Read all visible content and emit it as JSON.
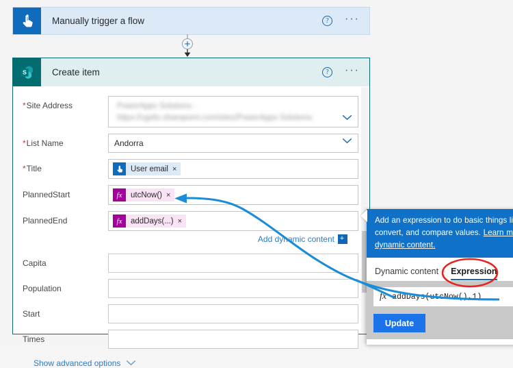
{
  "theme": {
    "trigger_accent": "#0f6cbd",
    "action_accent": "#036c70",
    "link_blue": "#2d7cc4",
    "annotation_blue": "#1a8cd8",
    "annotation_red": "#e8231e",
    "expression_magenta": "#a4009b",
    "update_button": "#1a73e8"
  },
  "trigger_card": {
    "title": "Manually trigger a flow",
    "icon": "tap-pointer-icon",
    "help_label": "?",
    "more_label": "···"
  },
  "connector": {
    "icon": "add-step-plus-icon"
  },
  "action_card": {
    "title": "Create item",
    "icon": "sharepoint-icon",
    "help_label": "?",
    "more_label": "···",
    "fields": [
      {
        "label": "Site Address",
        "required": true,
        "type": "dropdown-redacted",
        "value": "PowerApps Solutions - https://cgsltx.sharepoint.com/sites/PowerApps Solutions",
        "chevron": "chevron-down-icon"
      },
      {
        "label": "List Name",
        "required": true,
        "type": "dropdown",
        "value": "Andorra",
        "chevron": "chevron-down-icon"
      },
      {
        "label": "Title",
        "required": true,
        "type": "token",
        "token": {
          "kind": "dynamic",
          "icon": "tap-pointer-icon",
          "text": "User email",
          "remove": "×"
        }
      },
      {
        "label": "PlannedStart",
        "required": false,
        "type": "token",
        "token": {
          "kind": "expression",
          "icon": "fx",
          "text": "utcNow()",
          "remove": "×"
        }
      },
      {
        "label": "PlannedEnd",
        "required": false,
        "type": "token",
        "token": {
          "kind": "expression",
          "icon": "fx",
          "text": "addDays(...)",
          "remove": "×"
        }
      },
      {
        "label": "Capita",
        "required": false,
        "type": "text",
        "value": ""
      },
      {
        "label": "Population",
        "required": false,
        "type": "text",
        "value": ""
      },
      {
        "label": "Start",
        "required": false,
        "type": "text",
        "value": ""
      },
      {
        "label": "Times",
        "required": false,
        "type": "text",
        "value": ""
      }
    ],
    "add_dynamic_content": {
      "label": "Add dynamic content",
      "badge": "+"
    },
    "show_advanced": {
      "label": "Show advanced options",
      "chevron": "chevron-down-icon"
    }
  },
  "expression_panel": {
    "info_text_part1": "Add an expression to do basic things li",
    "info_text_part2": "convert, and compare values. ",
    "info_link1": "Learn m",
    "info_link2": "dynamic content.",
    "tabs": [
      {
        "label": "Dynamic content",
        "active": false
      },
      {
        "label": "Expression",
        "active": true
      }
    ],
    "expression_input": {
      "fx_label": "fx",
      "value": "addDays(utcNow(),1)"
    },
    "update_label": "Update"
  },
  "annotations": {
    "arrow_description": "blue-curved-arrow-from-expression-to-plannedend",
    "highlight_description": "red-ellipse-around-expression-tab"
  }
}
